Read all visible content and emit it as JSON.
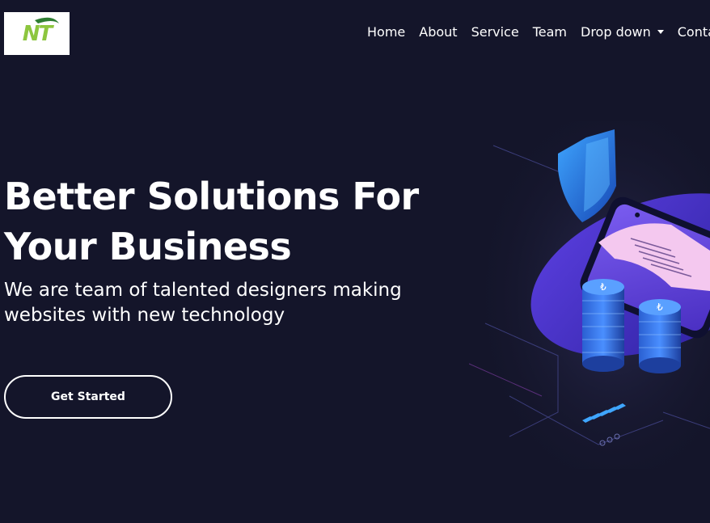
{
  "header": {
    "logo_text": "NT",
    "logo_color": "#8dc63f",
    "nav": [
      {
        "label": "Home"
      },
      {
        "label": "About"
      },
      {
        "label": "Service"
      },
      {
        "label": "Team"
      },
      {
        "label": "Drop down"
      },
      {
        "label": "Contact"
      }
    ]
  },
  "hero": {
    "title_line1": "Better Solutions For",
    "title_line2": "Your Business",
    "subtitle_line1": "We are team of talented designers making",
    "subtitle_line2": "websites with new technology",
    "cta_label": "Get Started"
  },
  "colors": {
    "background": "#14152a",
    "text": "#ffffff",
    "accent": "#6c4be8"
  }
}
